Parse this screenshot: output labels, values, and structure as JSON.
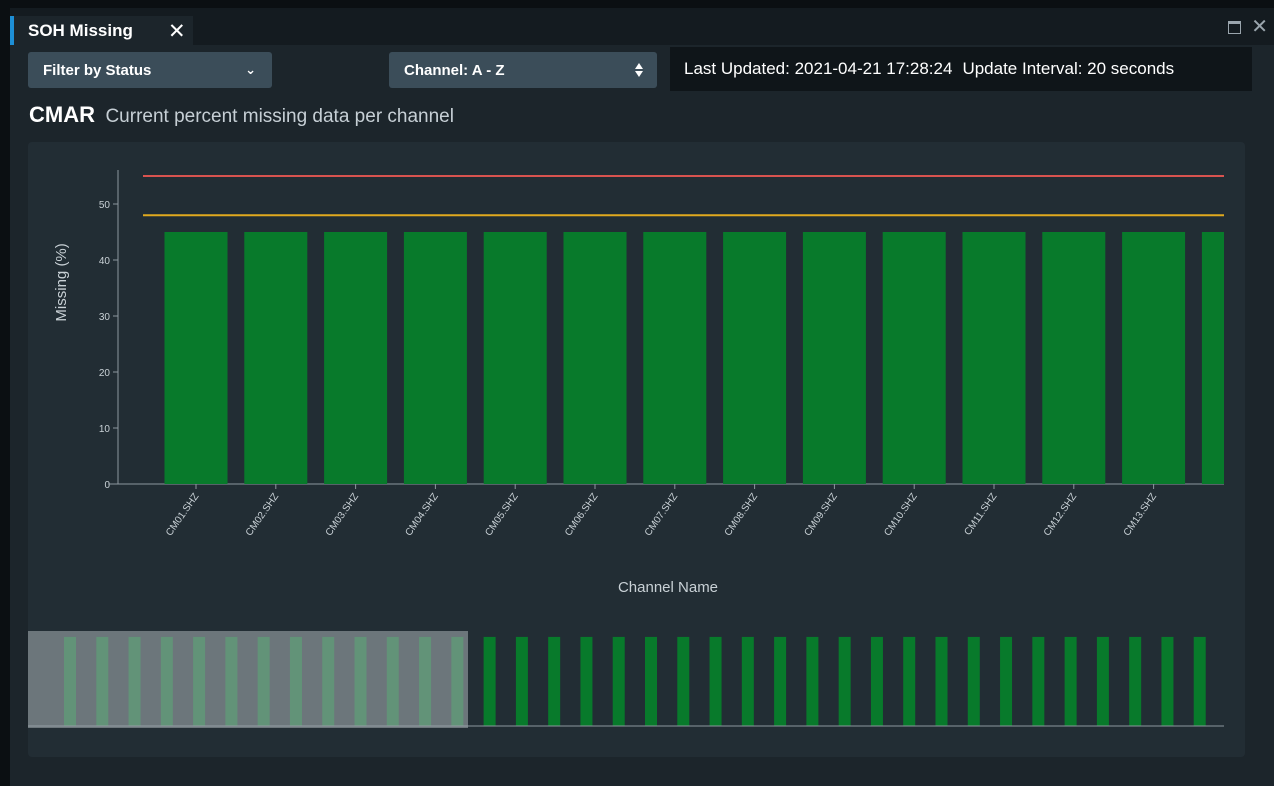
{
  "tab": {
    "title": "SOH Missing"
  },
  "toolbar": {
    "filter_label": "Filter by Status",
    "sort_label": "Channel: A - Z",
    "last_updated": "Last Updated: 2021-04-21 17:28:24",
    "update_interval": "Update Interval: 20 seconds"
  },
  "heading": {
    "station": "CMAR",
    "subtitle": "Current percent missing data per channel"
  },
  "colors": {
    "bar": "#087a2b",
    "error_threshold": "#d9534f",
    "warning_threshold": "#e0a91e",
    "brush_selection": "#9aa3a8",
    "tab_accent": "#1d8fd6"
  },
  "chart_data": {
    "type": "bar",
    "xlabel": "Channel Name",
    "ylabel": "Missing (%)",
    "ylim": [
      0,
      56
    ],
    "yticks": [
      0,
      10,
      20,
      30,
      40,
      50
    ],
    "categories": [
      "CM01.SHZ",
      "CM02.SHZ",
      "CM03.SHZ",
      "CM04.SHZ",
      "CM05.SHZ",
      "CM06.SHZ",
      "CM07.SHZ",
      "CM08.SHZ",
      "CM09.SHZ",
      "CM10.SHZ",
      "CM11.SHZ",
      "CM12.SHZ",
      "CM13.SHZ",
      ""
    ],
    "values": [
      45,
      45,
      45,
      45,
      45,
      45,
      45,
      45,
      45,
      45,
      45,
      45,
      45,
      45
    ],
    "thresholds": {
      "error": 55,
      "warning": 48
    },
    "overview": {
      "values": [
        45,
        45,
        45,
        45,
        45,
        45,
        45,
        45,
        45,
        45,
        45,
        45,
        45,
        45,
        45,
        45,
        45,
        45,
        45,
        45,
        45,
        45,
        45,
        45,
        45,
        45,
        45,
        45,
        45,
        45,
        45,
        45,
        45,
        45,
        45,
        45
      ],
      "selected_fraction": 0.36
    }
  }
}
